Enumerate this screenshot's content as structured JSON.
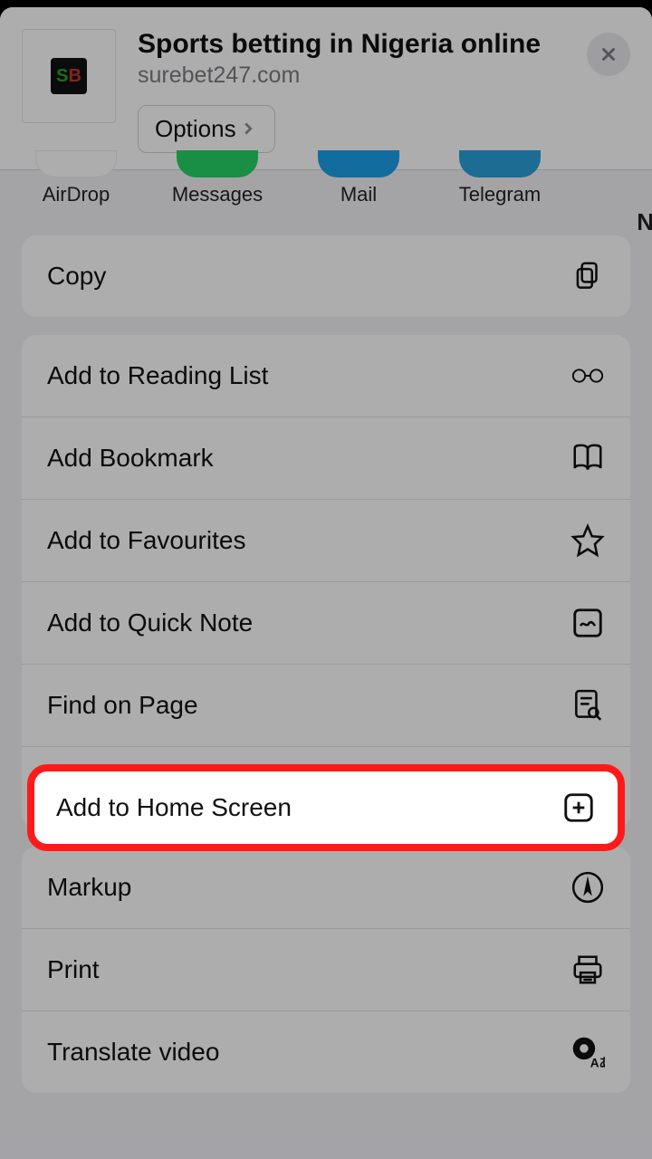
{
  "header": {
    "title": "Sports betting in Nigeria online",
    "url": "surebet247.com",
    "options_label": "Options",
    "site_icon_text": {
      "s": "S",
      "b": "B"
    }
  },
  "share_targets": [
    {
      "label": "AirDrop",
      "color": "#ffffff"
    },
    {
      "label": "Messages",
      "color": "#25d366"
    },
    {
      "label": "Mail",
      "color": "#1ba0e8"
    },
    {
      "label": "Telegram",
      "color": "#2aa0da"
    }
  ],
  "partial_next_label": "N",
  "groups": [
    {
      "id": "copy-group",
      "rows": [
        {
          "id": "copy",
          "label": "Copy",
          "icon": "copy-icon"
        }
      ]
    },
    {
      "id": "add-group",
      "rows": [
        {
          "id": "reading-list",
          "label": "Add to Reading List",
          "icon": "glasses-icon"
        },
        {
          "id": "bookmark",
          "label": "Add Bookmark",
          "icon": "book-icon"
        },
        {
          "id": "favourites",
          "label": "Add to Favourites",
          "icon": "star-icon"
        },
        {
          "id": "quick-note",
          "label": "Add to Quick Note",
          "icon": "quicknote-icon"
        },
        {
          "id": "find",
          "label": "Find on Page",
          "icon": "find-icon"
        },
        {
          "id": "home-screen",
          "label": "Add to Home Screen",
          "icon": "plus-app-icon"
        }
      ]
    },
    {
      "id": "util-group",
      "rows": [
        {
          "id": "markup",
          "label": "Markup",
          "icon": "markup-icon"
        },
        {
          "id": "print",
          "label": "Print",
          "icon": "print-icon"
        },
        {
          "id": "translate",
          "label": "Translate video",
          "icon": "translate-icon"
        }
      ]
    }
  ],
  "highlighted_row_id": "home-screen"
}
